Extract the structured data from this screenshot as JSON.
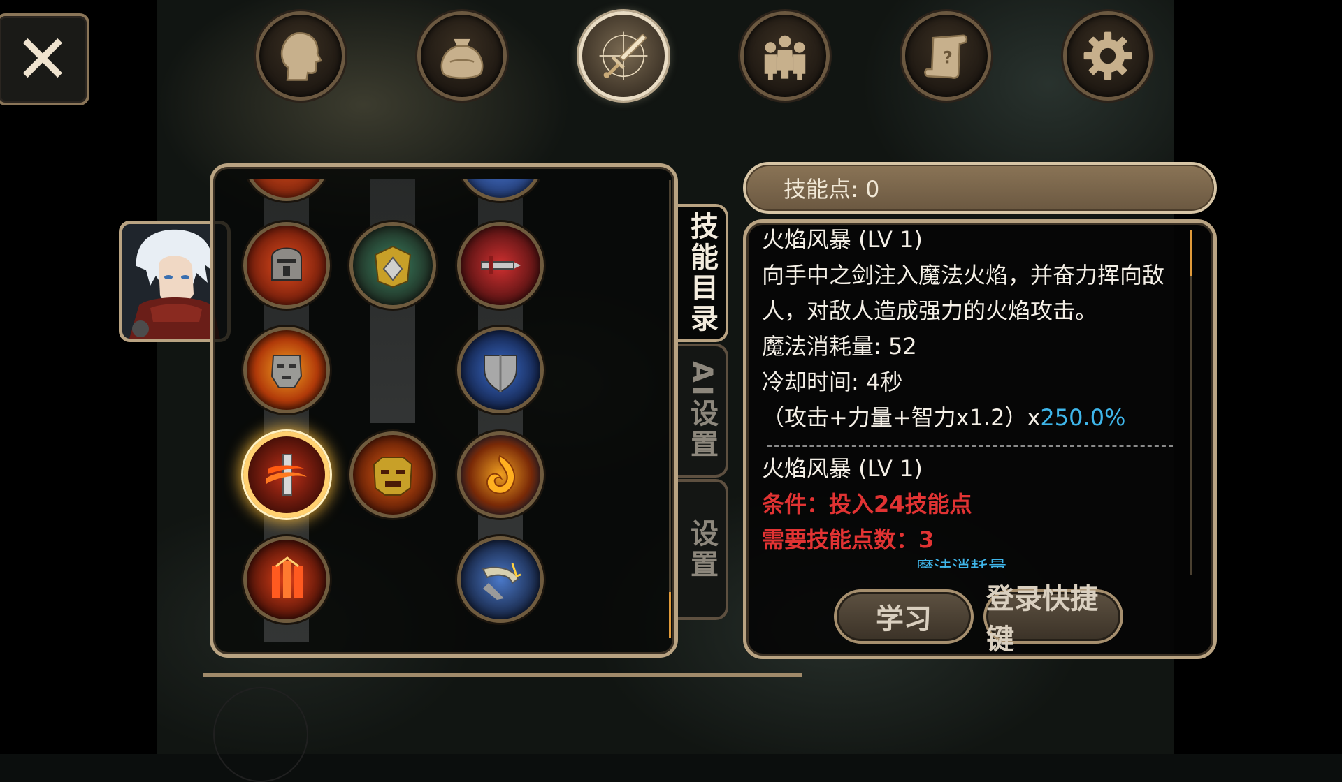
{
  "close_button": {
    "icon": "close-icon",
    "glyph": "✕"
  },
  "top_tabs": [
    {
      "name": "character-tab",
      "icon": "head-icon",
      "active": false
    },
    {
      "name": "inventory-tab",
      "icon": "bag-icon",
      "active": false
    },
    {
      "name": "skills-tab",
      "icon": "sword-compass-icon",
      "active": true
    },
    {
      "name": "party-tab",
      "icon": "people-icon",
      "active": false
    },
    {
      "name": "quest-tab",
      "icon": "scroll-icon",
      "active": false
    },
    {
      "name": "settings-tab",
      "icon": "gear-icon",
      "active": false
    }
  ],
  "side_tabs": [
    {
      "label": "技能目录",
      "active": true
    },
    {
      "label": "AI设置",
      "active": false
    },
    {
      "label": "设置",
      "active": false
    }
  ],
  "skill_points": {
    "label": "技能点: 0"
  },
  "skill_tree": {
    "nodes": [
      {
        "name": "skill-fire-helmet",
        "icon": "fire-helmet-icon",
        "col": 0,
        "row": 0
      },
      {
        "name": "skill-golden-armor",
        "icon": "golden-armor-icon",
        "col": 1,
        "row": 0
      },
      {
        "name": "skill-red-sword",
        "icon": "red-sword-icon",
        "col": 2,
        "row": 0
      },
      {
        "name": "skill-stone-face",
        "icon": "stone-face-icon",
        "col": 0,
        "row": 1
      },
      {
        "name": "skill-blue-shield",
        "icon": "blue-shield-icon",
        "col": 2,
        "row": 1
      },
      {
        "name": "skill-fire-storm",
        "icon": "flame-sword-icon",
        "col": 0,
        "row": 2,
        "selected": true
      },
      {
        "name": "skill-lion-roar",
        "icon": "lion-icon",
        "col": 1,
        "row": 2
      },
      {
        "name": "skill-fire-swirl",
        "icon": "fire-swirl-icon",
        "col": 2,
        "row": 2
      },
      {
        "name": "skill-fire-pillar",
        "icon": "fire-pillar-icon",
        "col": 0,
        "row": 3
      },
      {
        "name": "skill-lightning-slash",
        "icon": "lightning-slash-icon",
        "col": 2,
        "row": 3
      }
    ]
  },
  "info": {
    "title": "火焰风暴 (LV 1)",
    "description": "向手中之剑注入魔法火焰，并奋力挥向敌人，对敌人造成强力的火焰攻击。",
    "mana_cost": "魔法消耗量: 52",
    "cooldown": "冷却时间: 4秒",
    "formula_prefix": "（攻击+力量+智力x1.2）x",
    "formula_value": "250.0%",
    "next_title": "火焰风暴 (LV 1)",
    "condition": "条件：投入24技能点",
    "required_points": "需要技能点数：3",
    "cut_off_line": "魔法消耗量"
  },
  "buttons": {
    "learn": "学习",
    "register_hotkey": "登录快捷键"
  },
  "colors": {
    "accent": "#3fb6ea",
    "requirement": "#e13333",
    "frame": "#b9a382",
    "selection": "#ffd070"
  }
}
